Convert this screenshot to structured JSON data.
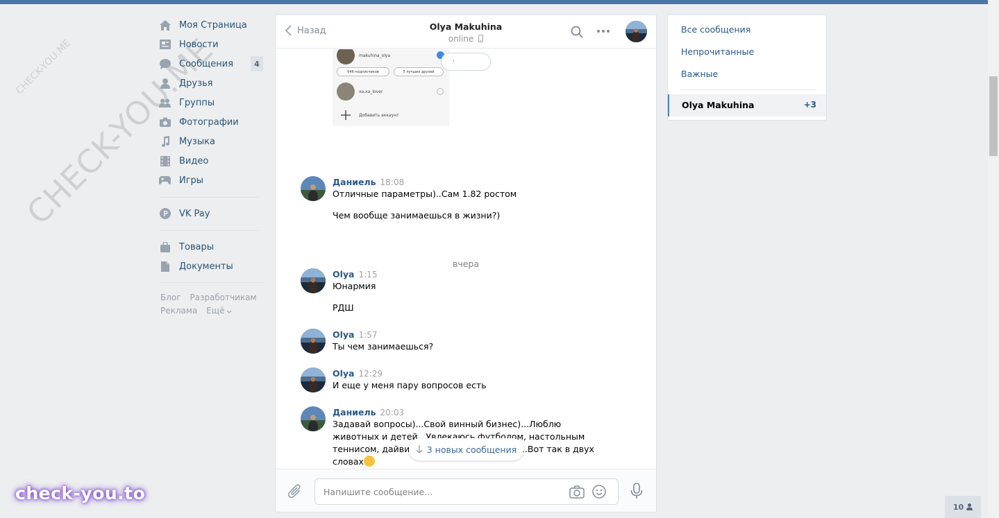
{
  "watermarks": {
    "small": "CHECK-YOU.ME",
    "large": "CHECK-YOU.ME"
  },
  "sidebar": {
    "items": [
      {
        "label": "Моя Страница",
        "icon": "home-icon"
      },
      {
        "label": "Новости",
        "icon": "news-icon"
      },
      {
        "label": "Сообщения",
        "icon": "messages-icon",
        "badge": "4"
      },
      {
        "label": "Друзья",
        "icon": "friend-icon"
      },
      {
        "label": "Группы",
        "icon": "groups-icon"
      },
      {
        "label": "Фотографии",
        "icon": "camera-icon"
      },
      {
        "label": "Музыка",
        "icon": "music-icon"
      },
      {
        "label": "Видео",
        "icon": "video-icon"
      },
      {
        "label": "Игры",
        "icon": "gamepad-icon"
      }
    ],
    "pay": {
      "label": "VK Pay",
      "icon": "vkpay-icon"
    },
    "extra": [
      {
        "label": "Товары",
        "icon": "bag-icon"
      },
      {
        "label": "Документы",
        "icon": "document-icon"
      }
    ],
    "footer": {
      "blog": "Блог",
      "dev": "Разработчикам",
      "ads": "Реклама",
      "more": "Ещё"
    }
  },
  "chat": {
    "back_label": "Назад",
    "peer_name": "Olya Makuhina",
    "peer_status": "online",
    "screenshot": {
      "username": "makuhina_olya",
      "followers": "646 подписчиков",
      "best_friends": "5 лучших друзей",
      "account2": "xa.xa_lover",
      "add_account": "Добавить аккаунт",
      "bubble": "·"
    },
    "messages": [
      {
        "author": "Даниель",
        "time": "18:08",
        "lines": [
          "Отличные параметры)..Сам 1.82 ростом",
          "Чем вообще занимаешься в жизни?)"
        ]
      },
      {
        "author": "Olya",
        "time": "1:15",
        "lines": [
          "Юнармия",
          "РДШ"
        ]
      },
      {
        "author": "Olya",
        "time": "1:57",
        "lines": [
          "Ты чем занимаешься?"
        ]
      },
      {
        "author": "Olya",
        "time": "12:29",
        "lines": [
          "И еще у меня пару вопросов есть"
        ]
      },
      {
        "author": "Даниель",
        "time": "20:03",
        "lines": [
          "Задавай вопросы)...Свой винный бизнес)...Люблю животных и детей...Увлекаюсь футболом, настольным теннисом, дайвингом и конным спортом...Вот так в двух словах"
        ]
      }
    ],
    "day_separator": "вчера",
    "new_messages_label": "3 новых сообщения",
    "composer_placeholder": "Напишите сообщение..."
  },
  "right_panel": {
    "all": "Все сообщения",
    "unread": "Непрочитанные",
    "important": "Важные",
    "active_name": "Olya Makuhina",
    "active_count": "+3"
  },
  "online_count": "10",
  "brand": "check-you.to",
  "colors": {
    "accent": "#4a76a8",
    "link": "#2a5885",
    "background": "#edeef0"
  }
}
